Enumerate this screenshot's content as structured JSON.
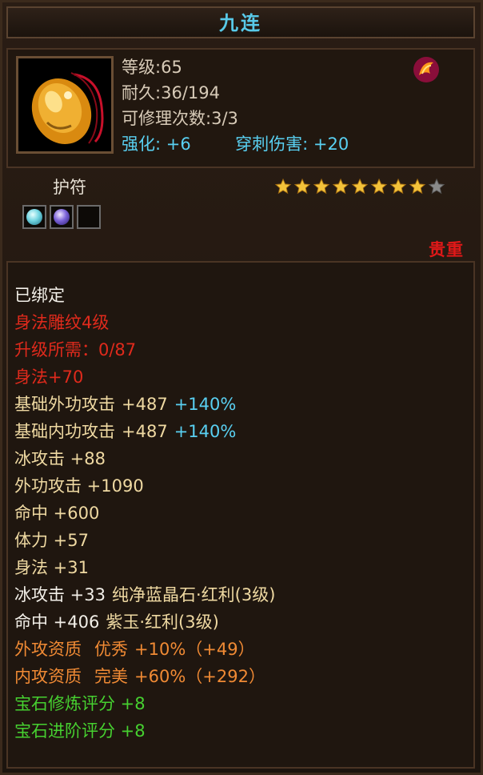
{
  "item": {
    "name": "九连",
    "level_label": "等级:",
    "level": "65",
    "durability_label": "耐久:",
    "durability": "36/194",
    "repair_label": "可修理次数:",
    "repair": "3/3",
    "enhance_label": "强化:",
    "enhance": "+6",
    "pierce_label": "穿刺伤害:",
    "pierce": "+20",
    "slot": "护符",
    "stars_filled": 8,
    "stars_total": 9,
    "rarity": "贵重"
  },
  "sockets": [
    {
      "icon": "blue-gem-icon",
      "color": "#6fd3e0"
    },
    {
      "icon": "purple-gem-icon",
      "color": "#7a62d8"
    },
    {
      "icon": "empty-socket",
      "color": "#0d0a07"
    }
  ],
  "lines": {
    "bound": "已绑定",
    "skill_level": "身法雕纹4级",
    "upgrade_req": "升级所需：0/87",
    "skill_bonus": "身法+70",
    "attr1_name": "基础外功攻击",
    "attr1_val": "+487",
    "attr1_pct": "+140%",
    "attr2_name": "基础内功攻击",
    "attr2_val": "+487",
    "attr2_pct": "+140%",
    "attr3": "冰攻击 +88",
    "attr4": "外功攻击 +1090",
    "attr5": "命中 +600",
    "attr6": "体力 +57",
    "attr7": "身法 +31",
    "gem1_stat": "冰攻击 +33",
    "gem1_name": "纯净蓝晶石·红利(3级)",
    "gem2_stat": "命中 +406",
    "gem2_name": "紫玉·红利(3级)",
    "quality1_name": "外攻资质",
    "quality1_grade": "优秀",
    "quality1_val": "+10%（+49）",
    "quality2_name": "内攻资质",
    "quality2_grade": "完美",
    "quality2_val": "+60%（+292）",
    "score1": "宝石修炼评分 +8",
    "score2": "宝石进阶评分 +8"
  },
  "colors": {
    "title": "#58c9e8",
    "stat_white": "#f2efe8",
    "red": "#e02a1c",
    "gold": "#efd9a2",
    "cyan": "#59d0f2",
    "orange": "#f08a34",
    "green": "#46d030"
  }
}
